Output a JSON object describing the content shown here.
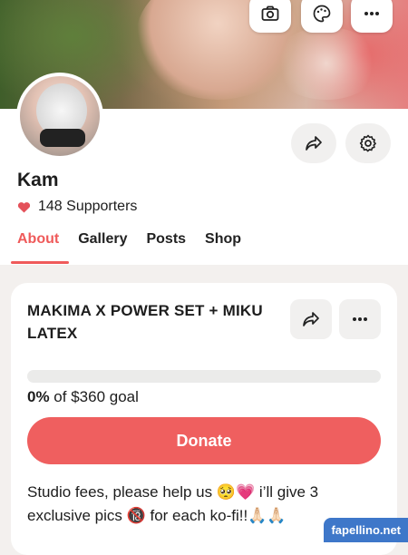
{
  "profile": {
    "name": "Kam",
    "supporters_text": "148 Supporters"
  },
  "tabs": [
    {
      "label": "About",
      "active": true
    },
    {
      "label": "Gallery"
    },
    {
      "label": "Posts"
    },
    {
      "label": "Shop"
    }
  ],
  "goal_card": {
    "title": "MAKIMA X POWER SET + MIKU LATEX",
    "progress_fraction": 0,
    "percent_text": "0%",
    "goal_text": " of $360 goal",
    "donate_label": "Donate",
    "description": "Studio fees, please help us 🥺💗 i’ll give 3 exclusive pics 🔞 for each ko-fi!!🙏🏻🙏🏻"
  },
  "watermark": "fapellino.net",
  "colors": {
    "accent": "#ef5a5a",
    "heart": "#e4515a",
    "watermark_bg": "#3e77c9"
  },
  "icons": {
    "cover_buttons": [
      "camera-icon",
      "palette-icon",
      "more-icon"
    ],
    "profile_buttons": [
      "share-icon",
      "gear-icon"
    ],
    "card_buttons": [
      "share-icon",
      "more-icon"
    ]
  }
}
